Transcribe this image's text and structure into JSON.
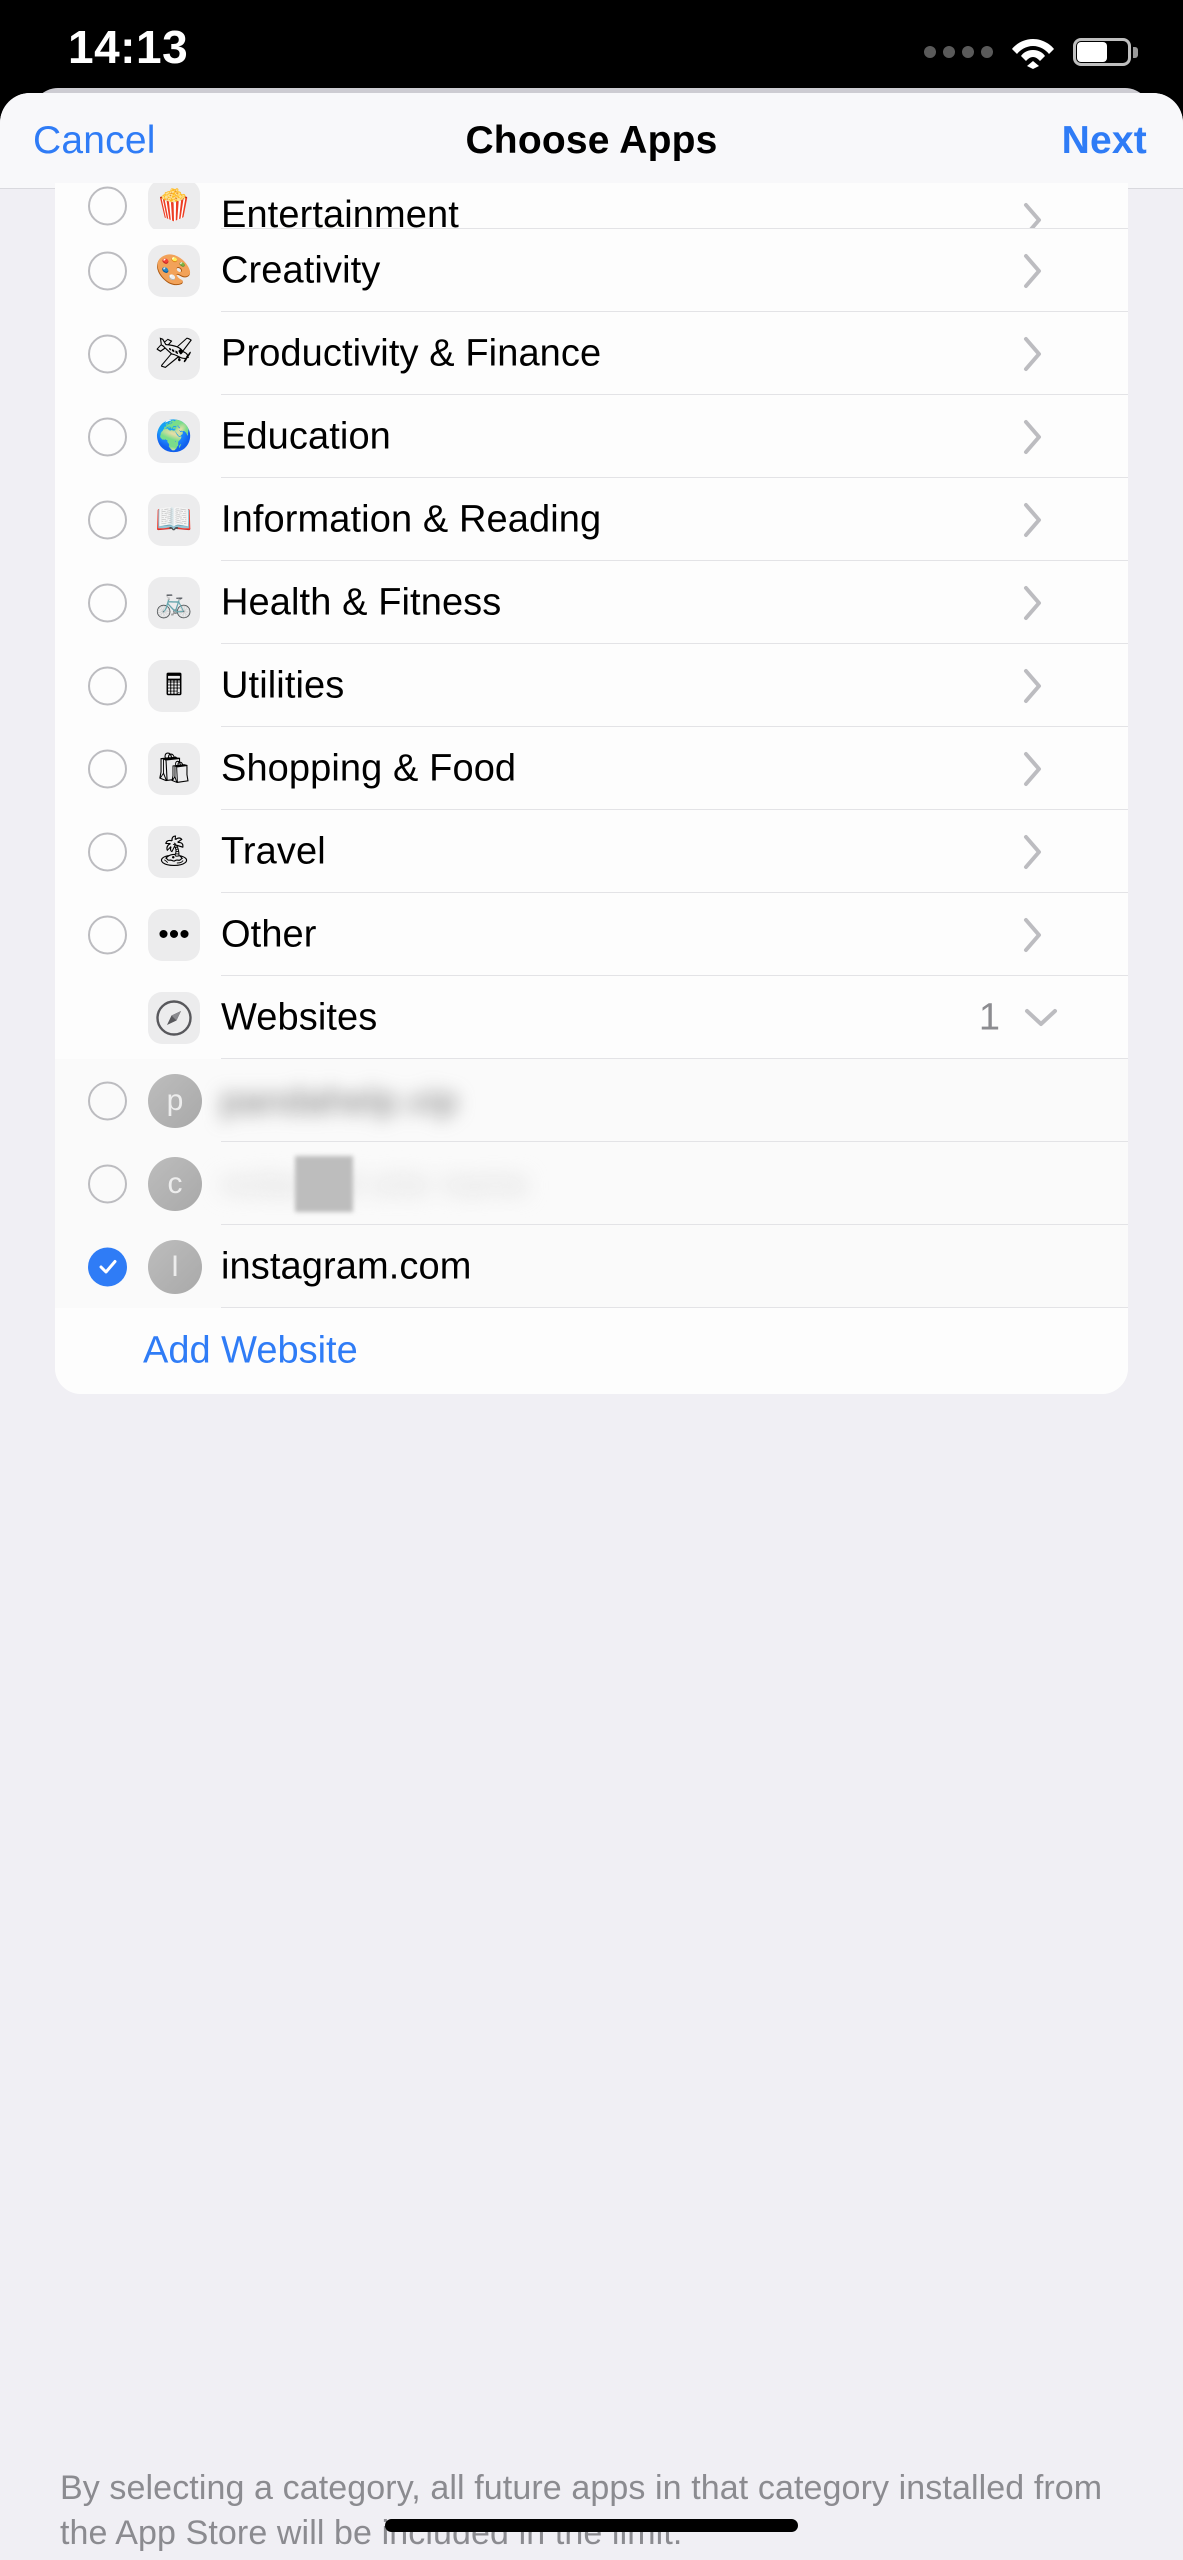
{
  "status_bar": {
    "time": "14:13",
    "signal_icon": "signal-dots-icon",
    "wifi_icon": "wifi-icon",
    "battery_icon": "battery-icon",
    "battery_level_percent": 52
  },
  "navbar": {
    "cancel_label": "Cancel",
    "title": "Choose Apps",
    "next_label": "Next"
  },
  "categories": [
    {
      "label": "Entertainment",
      "icon": "🍿",
      "icon_name": "popcorn-icon",
      "checked": false,
      "clipped": true
    },
    {
      "label": "Creativity",
      "icon": "🎨",
      "icon_name": "palette-icon",
      "checked": false,
      "clipped": false
    },
    {
      "label": "Productivity & Finance",
      "icon": "🛩",
      "icon_name": "paper-plane-icon",
      "checked": false,
      "clipped": false
    },
    {
      "label": "Education",
      "icon": "🌍",
      "icon_name": "globe-icon",
      "checked": false,
      "clipped": false
    },
    {
      "label": "Information & Reading",
      "icon": "📖",
      "icon_name": "open-book-icon",
      "checked": false,
      "clipped": false
    },
    {
      "label": "Health & Fitness",
      "icon": "🚲",
      "icon_name": "bicycle-icon",
      "checked": false,
      "clipped": false
    },
    {
      "label": "Utilities",
      "icon": "🖩",
      "icon_name": "calculator-icon",
      "checked": false,
      "clipped": false
    },
    {
      "label": "Shopping & Food",
      "icon": "🛍",
      "icon_name": "shopping-bag-icon",
      "checked": false,
      "clipped": false
    },
    {
      "label": "Travel",
      "icon": "🏝",
      "icon_name": "island-icon",
      "checked": false,
      "clipped": false
    },
    {
      "label": "Other",
      "icon": "•••",
      "icon_name": "ellipsis-icon",
      "checked": false,
      "clipped": false
    }
  ],
  "websites_section": {
    "label": "Websites",
    "icon_name": "safari-compass-icon",
    "count": "1",
    "expanded": true,
    "disclosure_icon": "chevron-down-icon",
    "items": [
      {
        "label": "",
        "avatar_letter": "p",
        "checked": false,
        "redacted": true,
        "redaction_style": "blur-text"
      },
      {
        "label": "",
        "avatar_letter": "c",
        "checked": false,
        "redacted": true,
        "redaction_style": "blur-box"
      },
      {
        "label": "instagram.com",
        "avatar_letter": "I",
        "checked": true,
        "redacted": false,
        "redaction_style": ""
      }
    ],
    "add_label": "Add Website"
  },
  "footer_text": "By selecting a category, all future apps in that category installed from the App Store will be included in the limit.",
  "colors": {
    "accent_blue": "#2f7cf6",
    "sheet_background": "#f0eff4",
    "card_background": "#fdfdfd",
    "divider": "#e3e3e6",
    "secondary_text": "#8b8b90"
  }
}
